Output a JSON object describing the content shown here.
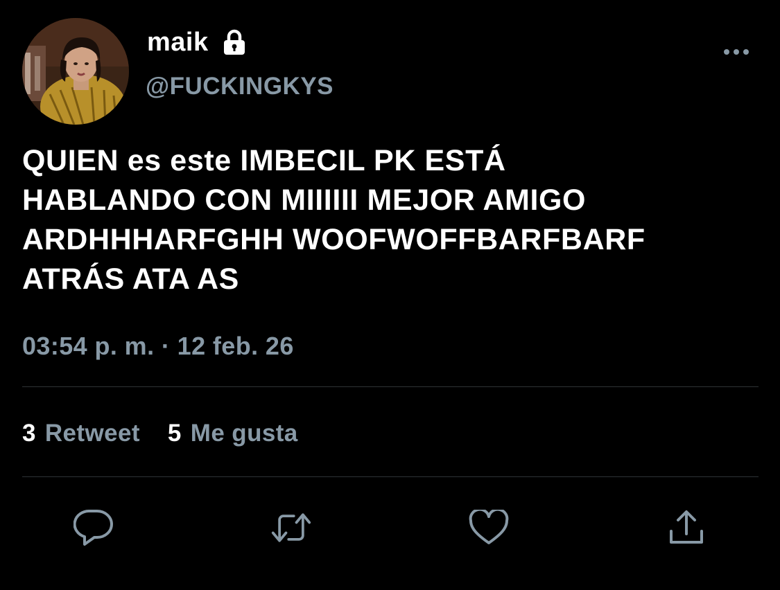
{
  "tweet": {
    "author": {
      "display_name": "maik",
      "handle": "@FUCKINGKYS",
      "protected_icon": "lock-icon",
      "avatar": "avatar-photo"
    },
    "more_icon": "more-dots-icon",
    "text": "QUIEN es este IMBECIL PK ESTÁ\nHABLANDO CON MIIIIII MEJOR AMIGO\nARDHHHARFGHH WOOFWOFFBARFBARF\nATRÁS ATA AS",
    "timestamp": "03:54 p. m. · 12 feb. 26",
    "stats": {
      "retweets": {
        "count": "3",
        "label": "Retweet"
      },
      "likes": {
        "count": "5",
        "label": "Me gusta"
      }
    },
    "actions": [
      {
        "name": "reply",
        "icon": "reply-icon"
      },
      {
        "name": "retweet",
        "icon": "retweet-icon"
      },
      {
        "name": "like",
        "icon": "heart-icon"
      },
      {
        "name": "share",
        "icon": "share-icon"
      }
    ]
  },
  "colors": {
    "background": "#000000",
    "primary_text": "#ffffff",
    "secondary_text": "#8899a6",
    "divider": "#2f3336"
  }
}
